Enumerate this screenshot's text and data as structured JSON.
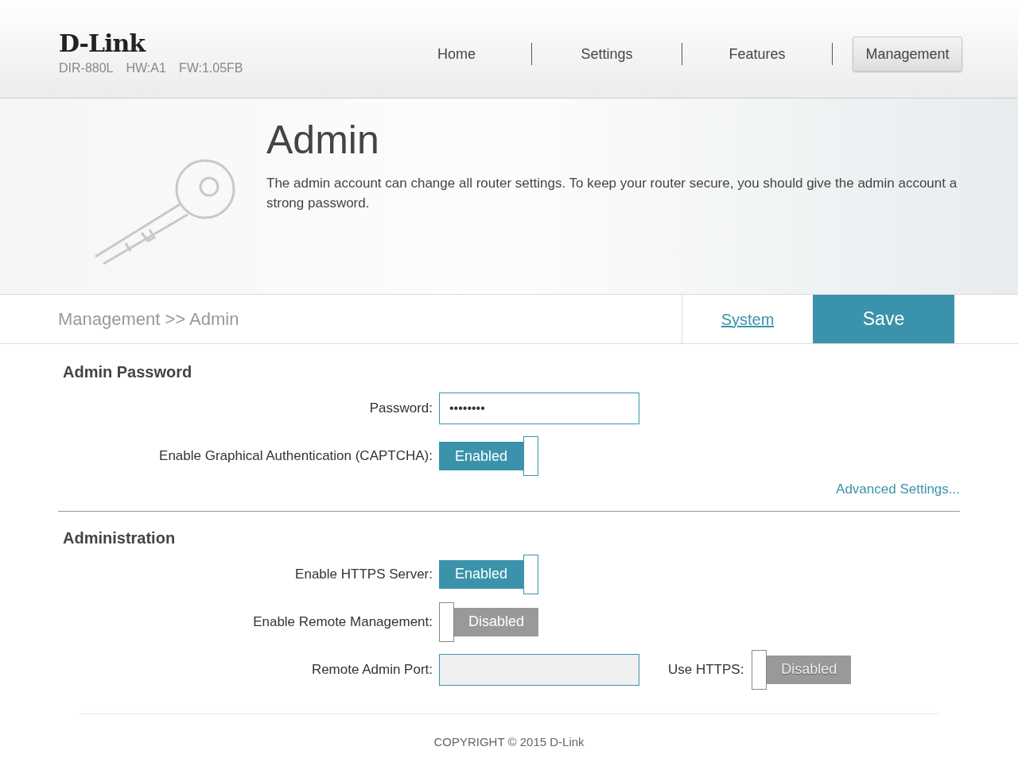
{
  "header": {
    "logo": "D-Link",
    "device_info": [
      "DIR-880L",
      "HW:A1",
      "FW:1.05FB"
    ],
    "nav": [
      {
        "label": "Home",
        "selected": false
      },
      {
        "label": "Settings",
        "selected": false
      },
      {
        "label": "Features",
        "selected": false
      },
      {
        "label": "Management",
        "selected": true
      }
    ]
  },
  "banner": {
    "title": "Admin",
    "description": "The admin account can change all router settings. To keep your router secure, you should give the admin account a strong password."
  },
  "toolbar": {
    "breadcrumb": "Management >> Admin",
    "system_link": "System",
    "save_button": "Save"
  },
  "sections": [
    {
      "title": "Admin Password",
      "fields": [
        {
          "kind": "password",
          "label": "Password:",
          "value": "••••••••"
        },
        {
          "kind": "toggle",
          "label": "Enable Graphical Authentication (CAPTCHA):",
          "on": true,
          "text": "Enabled"
        }
      ],
      "link": "Advanced Settings..."
    },
    {
      "title": "Administration",
      "fields": [
        {
          "kind": "toggle",
          "label": "Enable HTTPS Server:",
          "on": true,
          "text": "Enabled"
        },
        {
          "kind": "toggle",
          "label": "Enable Remote Management:",
          "on": false,
          "text": "Disabled"
        },
        {
          "kind": "text",
          "label": "Remote Admin Port:",
          "disabled": true,
          "extra": {
            "kind": "toggle",
            "label": "Use HTTPS:",
            "on": false,
            "disabled": true,
            "text": "Disabled"
          }
        }
      ]
    }
  ],
  "footer": "COPYRIGHT © 2015 D-Link"
}
